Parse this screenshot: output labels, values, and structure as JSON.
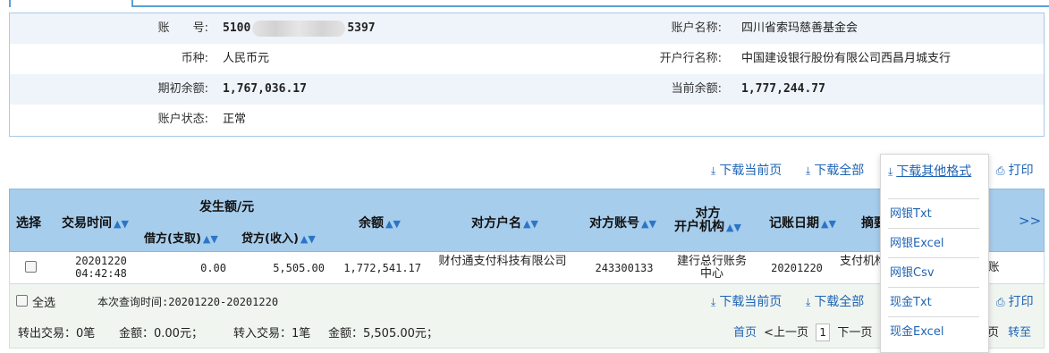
{
  "account": {
    "account_no_label": "账　　号:",
    "account_no_prefix": "5100",
    "account_no_suffix": "5397",
    "account_name_label": "账户名称:",
    "account_name": "四川省索玛慈善基金会",
    "currency_label": "币种:",
    "currency": "人民币元",
    "bank_label": "开户行名称:",
    "bank": "中国建设银行股份有限公司西昌月城支行",
    "opening_balance_label": "期初余额:",
    "opening_balance": "1,767,036.17",
    "current_balance_label": "当前余额:",
    "current_balance": "1,777,244.77",
    "status_label": "账户状态:",
    "status": "正常"
  },
  "actions": {
    "download_current": "下载当前页",
    "download_all": "下载全部",
    "download_other": "下载其他格式",
    "print": "打印"
  },
  "table": {
    "headers": {
      "select": "选择",
      "time": "交易时间",
      "amount_group": "发生额/元",
      "debit": "借方(支取)",
      "credit": "贷方(收入)",
      "balance": "余额",
      "counterparty_name": "对方户名",
      "counterparty_account": "对方账号",
      "counterparty_bank": "对方\n开户机构",
      "posting_date": "记账日期",
      "summary": "摘要",
      "more": ">>"
    },
    "rows": [
      {
        "time_date": "20201220",
        "time_clock": "04:42:48",
        "debit": "0.00",
        "credit": "5,505.00",
        "balance": "1,772,541.17",
        "counterparty_name": "财付通支付科技有限公司",
        "counterparty_account": "243300133",
        "counterparty_bank": "建行总行账务中心",
        "posting_date": "20201220",
        "summary": "支付机构",
        "tail": "账"
      }
    ]
  },
  "footer": {
    "select_all": "全选",
    "query_time": "本次查询时间:20201220-20201220",
    "out_txn": "转出交易：0笔",
    "out_amount": "金额：0.00元；",
    "in_txn": "转入交易：1笔",
    "in_amount": "金额：5,505.00元；",
    "download_current": "下载当前页",
    "download_all": "下载全部",
    "print": "打印"
  },
  "pager": {
    "first": "首页",
    "prev": "<上一页",
    "page": "1",
    "next": "下一页",
    "last_frag": "页",
    "goto": "转至"
  },
  "menu": {
    "items": [
      "网银Txt",
      "网银Excel",
      "网银Csv",
      "现金Txt",
      "现金Excel"
    ]
  },
  "colors": {
    "link": "#1f64b4",
    "header_bg": "#a7cdec",
    "alt_row": "#eef4fa",
    "tab_border": "#5a9fd6"
  }
}
